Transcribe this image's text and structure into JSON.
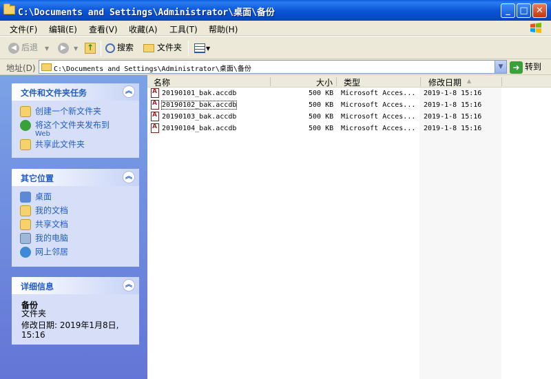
{
  "window": {
    "title": "C:\\Documents and Settings\\Administrator\\桌面\\备份"
  },
  "menu": [
    "文件(F)",
    "编辑(E)",
    "查看(V)",
    "收藏(A)",
    "工具(T)",
    "帮助(H)"
  ],
  "toolbar": {
    "back": "后退",
    "search": "搜索",
    "folders": "文件夹"
  },
  "address": {
    "label": "地址(D)",
    "path": "C:\\Documents and Settings\\Administrator\\桌面\\备份",
    "go": "转到"
  },
  "tasks_panel": {
    "title": "文件和文件夹任务",
    "items": [
      {
        "label": "创建一个新文件夹",
        "icon": "new-folder-icon"
      },
      {
        "label": "将这个文件夹发布到",
        "label2": "Web",
        "icon": "publish-web-icon"
      },
      {
        "label": "共享此文件夹",
        "icon": "share-folder-icon"
      }
    ]
  },
  "places_panel": {
    "title": "其它位置",
    "items": [
      {
        "label": "桌面",
        "icon": "desktop-icon"
      },
      {
        "label": "我的文档",
        "icon": "my-documents-icon"
      },
      {
        "label": "共享文档",
        "icon": "shared-documents-icon"
      },
      {
        "label": "我的电脑",
        "icon": "my-computer-icon"
      },
      {
        "label": "网上邻居",
        "icon": "network-places-icon"
      }
    ]
  },
  "details_panel": {
    "title": "详细信息",
    "name": "备份",
    "type": "文件夹",
    "modified_line1": "修改日期: 2019年1月8日,",
    "modified_line2": "15:16"
  },
  "columns": {
    "name": "名称",
    "size": "大小",
    "type": "类型",
    "modified": "修改日期"
  },
  "files": [
    {
      "name": "20190101_bak.accdb",
      "size": "500 KB",
      "type": "Microsoft Acces...",
      "modified": "2019-1-8 15:16"
    },
    {
      "name": "20190102_bak.accdb",
      "size": "500 KB",
      "type": "Microsoft Acces...",
      "modified": "2019-1-8 15:16"
    },
    {
      "name": "20190103_bak.accdb",
      "size": "500 KB",
      "type": "Microsoft Acces...",
      "modified": "2019-1-8 15:16"
    },
    {
      "name": "20190104_bak.accdb",
      "size": "500 KB",
      "type": "Microsoft Acces...",
      "modified": "2019-1-8 15:16"
    }
  ]
}
